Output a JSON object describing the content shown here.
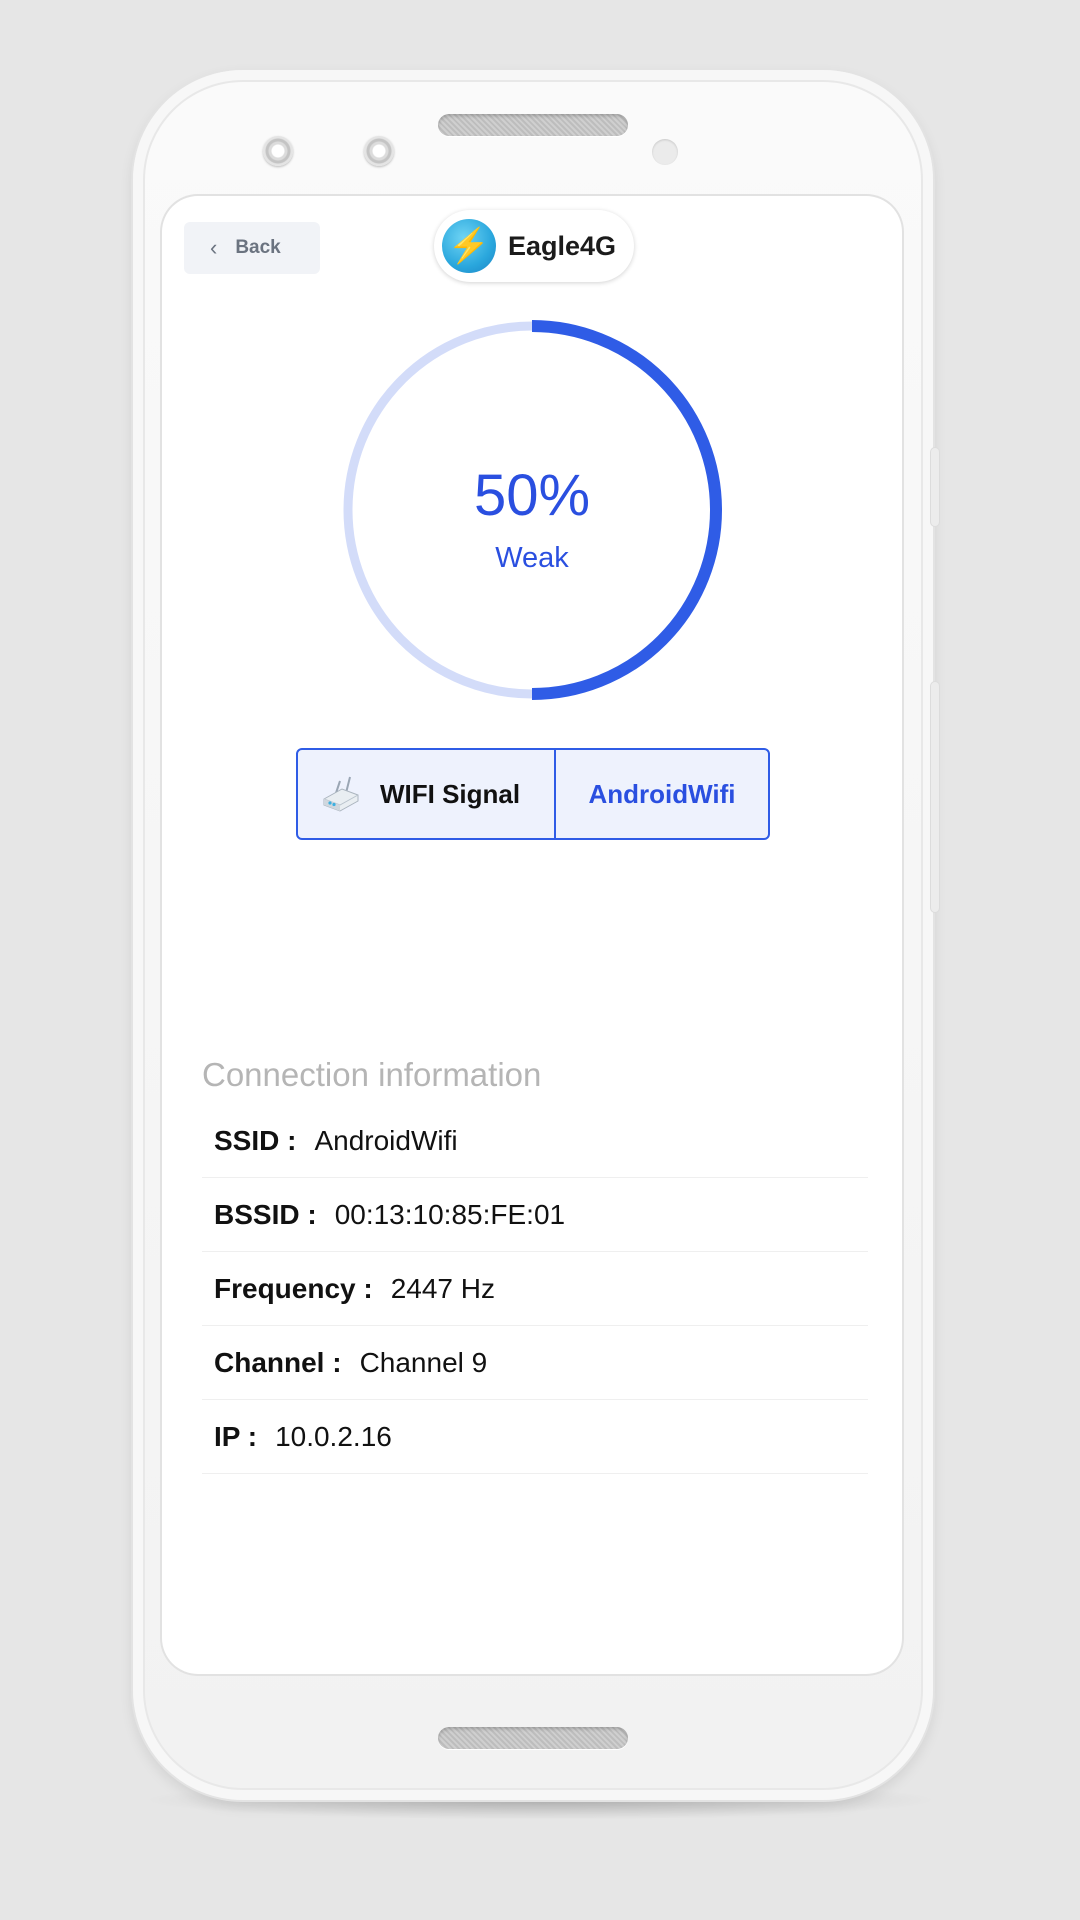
{
  "header": {
    "back_label": "Back",
    "app_name": "Eagle4G"
  },
  "gauge": {
    "percent_text": "50%",
    "percent_value": 50,
    "status": "Weak",
    "color_active": "#2f5ce6",
    "color_track": "#d3dcf9"
  },
  "signal": {
    "label": "WIFI Signal",
    "network": "AndroidWifi"
  },
  "connection": {
    "title": "Connection information",
    "rows": [
      {
        "key": "SSID :",
        "value": "AndroidWifi"
      },
      {
        "key": "BSSID :",
        "value": "00:13:10:85:FE:01"
      },
      {
        "key": "Frequency :",
        "value": "2447 Hz"
      },
      {
        "key": "Channel :",
        "value": "Channel 9"
      },
      {
        "key": "IP :",
        "value": "10.0.2.16"
      }
    ]
  }
}
